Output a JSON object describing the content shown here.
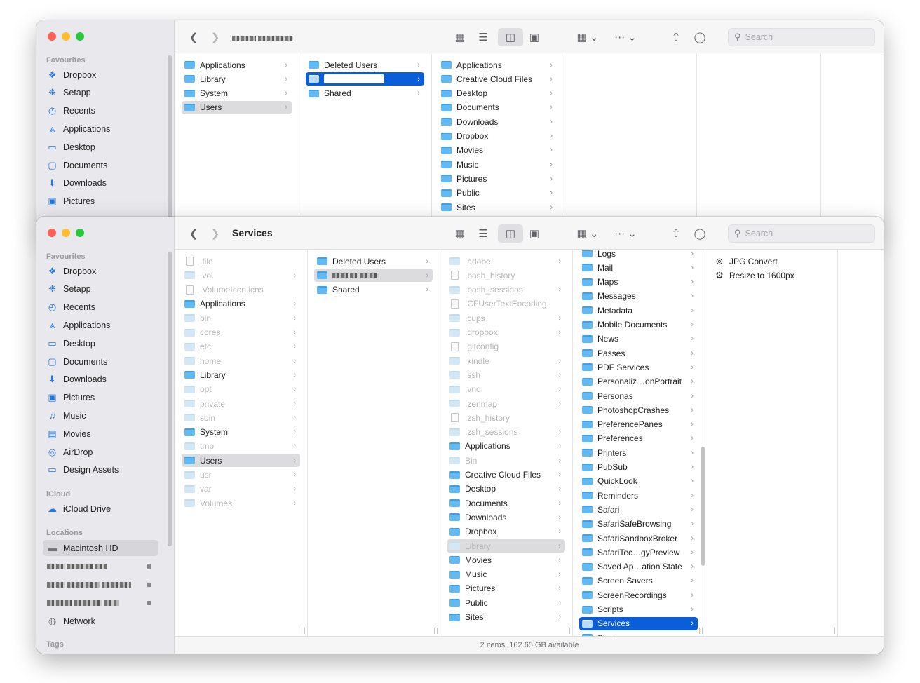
{
  "back_window": {
    "sidebar": {
      "section_favourites": "Favourites",
      "items": [
        {
          "label": "Dropbox",
          "icon": "dropbox-icon"
        },
        {
          "label": "Setapp",
          "icon": "setapp-icon"
        },
        {
          "label": "Recents",
          "icon": "clock-icon"
        },
        {
          "label": "Applications",
          "icon": "applications-icon"
        },
        {
          "label": "Desktop",
          "icon": "desktop-icon"
        },
        {
          "label": "Documents",
          "icon": "document-icon"
        },
        {
          "label": "Downloads",
          "icon": "download-icon"
        },
        {
          "label": "Pictures",
          "icon": "pictures-icon"
        }
      ]
    },
    "columns": [
      [
        {
          "label": "Applications",
          "chevron": true
        },
        {
          "label": "Library",
          "chevron": true
        },
        {
          "label": "System",
          "chevron": true
        },
        {
          "label": "Users",
          "chevron": true,
          "state": "gray"
        }
      ],
      [
        {
          "label": "Deleted Users",
          "chevron": true
        },
        {
          "label": "",
          "chevron": true,
          "state": "blue",
          "renaming": true
        },
        {
          "label": "Shared",
          "chevron": true
        }
      ],
      [
        {
          "label": "Applications",
          "chevron": true
        },
        {
          "label": "Creative Cloud Files",
          "chevron": true
        },
        {
          "label": "Desktop",
          "chevron": true
        },
        {
          "label": "Documents",
          "chevron": true
        },
        {
          "label": "Downloads",
          "chevron": true
        },
        {
          "label": "Dropbox",
          "chevron": true
        },
        {
          "label": "Movies",
          "chevron": true
        },
        {
          "label": "Music",
          "chevron": true
        },
        {
          "label": "Pictures",
          "chevron": true
        },
        {
          "label": "Public",
          "chevron": true
        },
        {
          "label": "Sites",
          "chevron": true
        }
      ]
    ],
    "search_placeholder": "Search"
  },
  "front_window": {
    "title": "Services",
    "search_placeholder": "Search",
    "status": "2 items, 162.65 GB available",
    "sidebar": {
      "section_favourites": "Favourites",
      "favourites": [
        {
          "label": "Dropbox",
          "icon": "dropbox-icon"
        },
        {
          "label": "Setapp",
          "icon": "setapp-icon"
        },
        {
          "label": "Recents",
          "icon": "clock-icon"
        },
        {
          "label": "Applications",
          "icon": "applications-icon"
        },
        {
          "label": "Desktop",
          "icon": "desktop-icon"
        },
        {
          "label": "Documents",
          "icon": "document-icon"
        },
        {
          "label": "Downloads",
          "icon": "download-icon"
        },
        {
          "label": "Pictures",
          "icon": "pictures-icon"
        },
        {
          "label": "Music",
          "icon": "music-icon"
        },
        {
          "label": "Movies",
          "icon": "movies-icon"
        },
        {
          "label": "AirDrop",
          "icon": "airdrop-icon"
        },
        {
          "label": "Design Assets",
          "icon": "folder-icon"
        }
      ],
      "section_icloud": "iCloud",
      "icloud": [
        {
          "label": "iCloud Drive",
          "icon": "cloud-icon"
        }
      ],
      "section_locations": "Locations",
      "locations": [
        {
          "label": "Macintosh HD",
          "icon": "disk-icon"
        }
      ],
      "network": {
        "label": "Network",
        "icon": "network-icon"
      },
      "section_tags": "Tags"
    },
    "columns": [
      [
        {
          "label": ".file",
          "dim": true,
          "type": "doc"
        },
        {
          "label": ".vol",
          "dim": true,
          "chevron": true
        },
        {
          "label": ".VolumeIcon.icns",
          "dim": true,
          "type": "doc"
        },
        {
          "label": "Applications",
          "chevron": true
        },
        {
          "label": "bin",
          "dim": true,
          "chevron": true
        },
        {
          "label": "cores",
          "dim": true,
          "chevron": true
        },
        {
          "label": "etc",
          "dim": true,
          "chevron": true
        },
        {
          "label": "home",
          "dim": true,
          "chevron": true
        },
        {
          "label": "Library",
          "chevron": true
        },
        {
          "label": "opt",
          "dim": true,
          "chevron": true
        },
        {
          "label": "private",
          "dim": true,
          "chevron": true
        },
        {
          "label": "sbin",
          "dim": true,
          "chevron": true
        },
        {
          "label": "System",
          "chevron": true
        },
        {
          "label": "tmp",
          "dim": true,
          "chevron": true
        },
        {
          "label": "Users",
          "chevron": true,
          "state": "gray"
        },
        {
          "label": "usr",
          "dim": true,
          "chevron": true
        },
        {
          "label": "var",
          "dim": true,
          "chevron": true
        },
        {
          "label": "Volumes",
          "dim": true,
          "chevron": true
        }
      ],
      [
        {
          "label": "Deleted Users",
          "chevron": true
        },
        {
          "label": "",
          "chevron": true,
          "state": "gray",
          "blurred": true
        },
        {
          "label": "Shared",
          "chevron": true
        }
      ],
      [
        {
          "label": ".adobe",
          "dim": true,
          "chevron": true
        },
        {
          "label": ".bash_history",
          "dim": true,
          "type": "doc"
        },
        {
          "label": ".bash_sessions",
          "dim": true,
          "chevron": true
        },
        {
          "label": ".CFUserTextEncoding",
          "dim": true,
          "type": "doc"
        },
        {
          "label": ".cups",
          "dim": true,
          "chevron": true
        },
        {
          "label": ".dropbox",
          "dim": true,
          "chevron": true
        },
        {
          "label": ".gitconfig",
          "dim": true,
          "type": "doc"
        },
        {
          "label": ".kindle",
          "dim": true,
          "chevron": true
        },
        {
          "label": ".ssh",
          "dim": true,
          "chevron": true
        },
        {
          "label": ".vnc",
          "dim": true,
          "chevron": true
        },
        {
          "label": ".zenmap",
          "dim": true,
          "chevron": true
        },
        {
          "label": ".zsh_history",
          "dim": true,
          "type": "doc"
        },
        {
          "label": ".zsh_sessions",
          "dim": true,
          "chevron": true
        },
        {
          "label": "Applications",
          "chevron": true
        },
        {
          "label": "Bin",
          "dim": true,
          "chevron": true
        },
        {
          "label": "Creative Cloud Files",
          "chevron": true
        },
        {
          "label": "Desktop",
          "chevron": true
        },
        {
          "label": "Documents",
          "chevron": true
        },
        {
          "label": "Downloads",
          "chevron": true
        },
        {
          "label": "Dropbox",
          "chevron": true
        },
        {
          "label": "Library",
          "chevron": true,
          "state": "gray",
          "dim": true
        },
        {
          "label": "Movies",
          "chevron": true
        },
        {
          "label": "Music",
          "chevron": true
        },
        {
          "label": "Pictures",
          "chevron": true
        },
        {
          "label": "Public",
          "chevron": true
        },
        {
          "label": "Sites",
          "chevron": true
        }
      ],
      [
        {
          "label": "Logs",
          "chevron": true
        },
        {
          "label": "Mail",
          "chevron": true
        },
        {
          "label": "Maps",
          "chevron": true
        },
        {
          "label": "Messages",
          "chevron": true
        },
        {
          "label": "Metadata",
          "chevron": true
        },
        {
          "label": "Mobile Documents",
          "chevron": true
        },
        {
          "label": "News",
          "chevron": true
        },
        {
          "label": "Passes",
          "chevron": true
        },
        {
          "label": "PDF Services",
          "chevron": true
        },
        {
          "label": "Personaliz…onPortrait",
          "chevron": true
        },
        {
          "label": "Personas",
          "chevron": true
        },
        {
          "label": "PhotoshopCrashes",
          "chevron": true
        },
        {
          "label": "PreferencePanes",
          "chevron": true
        },
        {
          "label": "Preferences",
          "chevron": true
        },
        {
          "label": "Printers",
          "chevron": true
        },
        {
          "label": "PubSub",
          "chevron": true
        },
        {
          "label": "QuickLook",
          "chevron": true
        },
        {
          "label": "Reminders",
          "chevron": true
        },
        {
          "label": "Safari",
          "chevron": true
        },
        {
          "label": "SafariSafeBrowsing",
          "chevron": true
        },
        {
          "label": "SafariSandboxBroker",
          "chevron": true
        },
        {
          "label": "SafariTec…gyPreview",
          "chevron": true
        },
        {
          "label": "Saved Ap…ation State",
          "chevron": true
        },
        {
          "label": "Screen Savers",
          "chevron": true
        },
        {
          "label": "ScreenRecordings",
          "chevron": true
        },
        {
          "label": "Scripts",
          "chevron": true
        },
        {
          "label": "Services",
          "chevron": true,
          "state": "blue"
        },
        {
          "label": "Sharing",
          "chevron": true
        }
      ],
      [
        {
          "label": "JPG Convert",
          "type": "workflow"
        },
        {
          "label": "Resize to 1600px",
          "type": "gear"
        }
      ]
    ]
  }
}
